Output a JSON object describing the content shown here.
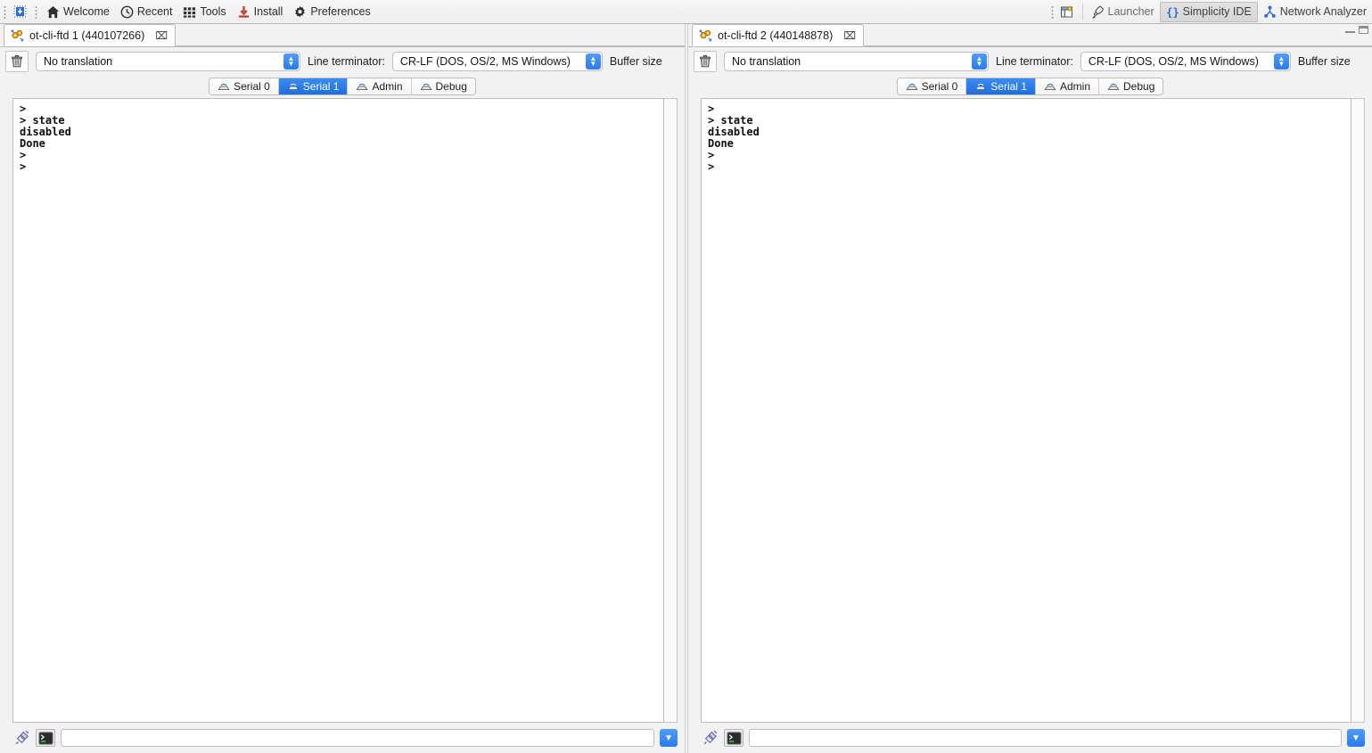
{
  "toolbar": {
    "chip_icon": "install-chip-icon",
    "items": [
      {
        "label": "Welcome",
        "icon": "home-icon"
      },
      {
        "label": "Recent",
        "icon": "clock-icon"
      },
      {
        "label": "Tools",
        "icon": "grid-icon"
      },
      {
        "label": "Install",
        "icon": "download-icon"
      },
      {
        "label": "Preferences",
        "icon": "gear-icon"
      }
    ],
    "perspective_icon": "new-perspective-icon",
    "perspectives": [
      {
        "label": "Launcher",
        "icon": "rocket-icon",
        "active": false
      },
      {
        "label": "Simplicity IDE",
        "icon": "braces-icon",
        "active": true
      },
      {
        "label": "Network Analyzer",
        "icon": "network-icon",
        "active": false
      }
    ]
  },
  "window_controls": {
    "minimize": "minimize-icon",
    "maximize": "maximize-icon"
  },
  "panels": [
    {
      "tab_title": "ot-cli-ftd 1 (440107266)",
      "tab_icon": "console-gears-icon",
      "close_glyph": "⌧",
      "clear_icon": "trash-icon",
      "translation": "No translation",
      "line_terminator_label": "Line terminator:",
      "line_terminator": "CR-LF  (DOS, OS/2, MS Windows)",
      "buffer_size_label": "Buffer size",
      "serial_tabs": [
        {
          "label": "Serial 0",
          "active": false
        },
        {
          "label": "Serial 1",
          "active": true
        },
        {
          "label": "Admin",
          "active": false
        },
        {
          "label": "Debug",
          "active": false
        }
      ],
      "terminal_output": ">\n> state\ndisabled\nDone\n>\n>",
      "command_value": "",
      "command_placeholder": "",
      "plug_icon": "plug-icon",
      "console_icon": "console-prompt-icon",
      "dropdown_icon": "chevron-down-icon"
    },
    {
      "tab_title": "ot-cli-ftd 2 (440148878)",
      "tab_icon": "console-gears-icon",
      "close_glyph": "⌧",
      "clear_icon": "trash-icon",
      "translation": "No translation",
      "line_terminator_label": "Line terminator:",
      "line_terminator": "CR-LF  (DOS, OS/2, MS Windows)",
      "buffer_size_label": "Buffer size",
      "serial_tabs": [
        {
          "label": "Serial 0",
          "active": false
        },
        {
          "label": "Serial 1",
          "active": true
        },
        {
          "label": "Admin",
          "active": false
        },
        {
          "label": "Debug",
          "active": false
        }
      ],
      "terminal_output": ">\n> state\ndisabled\nDone\n>\n>",
      "command_value": "",
      "command_placeholder": "",
      "plug_icon": "plug-icon",
      "console_icon": "console-prompt-icon",
      "dropdown_icon": "chevron-down-icon"
    }
  ],
  "colors": {
    "accent_blue": "#2a7bee",
    "active_tab_blue": "#1f6fe0",
    "toolbar_bg": "#f2f2f2",
    "terminal_bg": "#ffffff",
    "text": "#1a1a1a"
  }
}
